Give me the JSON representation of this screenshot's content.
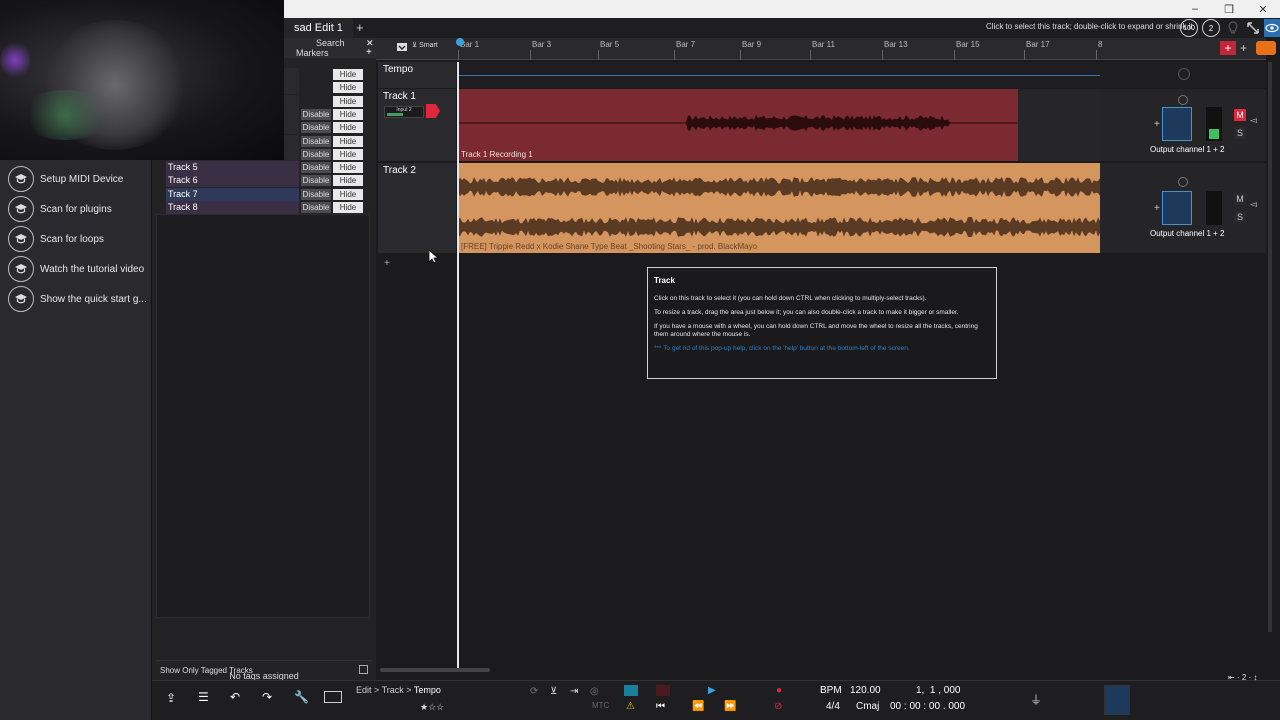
{
  "window": {
    "hint": "Click to select this track; double-click to expand or shrink it",
    "zoom_badge": "100",
    "small_badge": "2"
  },
  "edit_tab": {
    "title": "sad Edit 1",
    "add_tab": "+"
  },
  "tag_panel": {
    "search_label": "Search",
    "markers_label": "Markers",
    "add": "+",
    "rows": [
      {
        "name": "",
        "disable": "",
        "hide": "Hide"
      },
      {
        "name": "",
        "disable": "",
        "hide": "Hide"
      },
      {
        "name": "",
        "disable": "",
        "hide": "Hide"
      },
      {
        "name": "",
        "disable": "Disable",
        "hide": "Hide"
      },
      {
        "name": "",
        "disable": "Disable",
        "hide": "Hide"
      },
      {
        "name": "",
        "disable": "Disable",
        "hide": "Hide"
      },
      {
        "name": "",
        "disable": "Disable",
        "hide": "Hide"
      },
      {
        "name": "Track 5",
        "disable": "Disable",
        "hide": "Hide"
      },
      {
        "name": "Track 6",
        "disable": "Disable",
        "hide": "Hide"
      },
      {
        "name": "Track 7",
        "disable": "Disable",
        "hide": "Hide"
      },
      {
        "name": "Track 8",
        "disable": "Disable",
        "hide": "Hide"
      }
    ],
    "no_tags": "No tags assigned",
    "show_only_tagged": "Show Only Tagged Tracks"
  },
  "sidebar": {
    "items": [
      {
        "label": "Setup MIDI Device",
        "icon": "graduation-cap-icon"
      },
      {
        "label": "Scan for plugins",
        "icon": "graduation-cap-icon"
      },
      {
        "label": "Scan for loops",
        "icon": "graduation-cap-icon"
      },
      {
        "label": "Watch the tutorial video",
        "icon": "graduation-cap-icon"
      },
      {
        "label": "Show the quick start g...",
        "icon": "graduation-cap-icon"
      }
    ]
  },
  "toolbar": {
    "smart_label": "Smart"
  },
  "ruler": {
    "labels": [
      "Bar 1",
      "Bar 3",
      "Bar 5",
      "Bar 7",
      "Bar 9",
      "Bar 11",
      "Bar 13",
      "Bar 15",
      "Bar 17",
      "8"
    ]
  },
  "tempo_track": {
    "name": "Tempo"
  },
  "tracks": [
    {
      "name": "Track 1",
      "input": "Input 2",
      "clip_label": "Track 1 Recording 1",
      "output": "Output channel 1 + 2",
      "mute": "M",
      "solo": "S",
      "clip_color": "#7a2a30",
      "wave_color": "#2a0c0e"
    },
    {
      "name": "Track 2",
      "clip_label": "[FREE] Trippie Redd x Kodie Shane Type Beat _Shooting Stars_ - prod. BlackMayo",
      "output": "Output channel 1 + 2",
      "mute": "M",
      "solo": "S",
      "clip_color": "#d4955f",
      "wave_color": "#5a3a22"
    }
  ],
  "popup": {
    "title": "Track",
    "p1": "Click on this track to select it (you can hold down CTRL when clicking to multiply-select tracks).",
    "p2": "To resize a track, drag the area just below it; you can also double-click a track to make it bigger or smaller.",
    "p3": "If you have a mouse with a wheel, you can hold down CTRL and move the wheel to resize all the tracks, centring them around where the mouse is.",
    "hint": "*** To get rid of this pop-up help, click on the 'help' button at the bottom-left of the screen."
  },
  "transport": {
    "breadcrumb": [
      "Edit",
      "Track",
      "Tempo"
    ],
    "bpm_label": "BPM",
    "bpm": "120.00",
    "time_sig": "4/4",
    "key": "Cmaj",
    "bars_position": "1,  1 , 000",
    "time_position": "00 : 00 : 00 . 000",
    "mtc_label": "MTC"
  },
  "colors": {
    "accent_red": "#e0283c",
    "accent_blue": "#3aa0e0",
    "orange": "#e8711a"
  }
}
